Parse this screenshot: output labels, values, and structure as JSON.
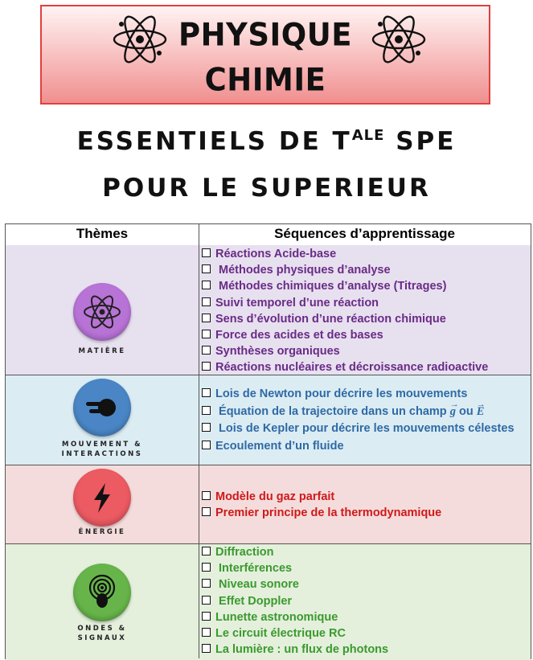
{
  "banner": {
    "line1": "PHYSIQUE",
    "line2": "CHIMIE",
    "icons": [
      "atom-icon",
      "atom-icon"
    ]
  },
  "subtitle": {
    "line1_before": "ESSENTIELS DE T",
    "line1_sup": "ALE",
    "line1_after": " SPE",
    "line2": "POUR LE SUPERIEUR"
  },
  "table": {
    "headers": [
      "Thèmes",
      "Séquences d’apprentissage"
    ],
    "rows": [
      {
        "theme": "MATIÈRE",
        "icon": "atom-icon",
        "color": "#b873d6",
        "text_color": "#6a2b86",
        "items": [
          "Réactions Acide-base",
          " Méthodes physiques d’analyse",
          " Méthodes chimiques d’analyse (Titrages)",
          "Suivi temporel d’une réaction",
          "Sens d’évolution d’une réaction chimique",
          "Force des acides et des bases",
          "Synthèses organiques",
          "Réactions nucléaires et décroissance radioactive"
        ]
      },
      {
        "theme": "MOUVEMENT & INTERACTIONS",
        "theme_line1": "MOUVEMENT &",
        "theme_line2": "INTERACTIONS",
        "icon": "moving-object-icon",
        "color": "#4a86c6",
        "text_color": "#2e6aa6",
        "items": [
          "Lois de Newton pour décrire les mouvements",
          " Équation de la trajectoire dans un champ",
          " Lois de Kepler pour décrire les mouvements célestes",
          "Ecoulement d’un fluide"
        ],
        "item2_vec_g": "g",
        "item2_ou": "ou",
        "item2_vec_e": "E"
      },
      {
        "theme": "ÉNERGIE",
        "icon": "lightning-icon",
        "color": "#ec5a62",
        "text_color": "#d01919",
        "items": [
          "Modèle du gaz parfait",
          "Premier principe de la thermodynamique"
        ]
      },
      {
        "theme": "ONDES & SIGNAUX",
        "theme_line1": "ONDES &",
        "theme_line2": "SIGNAUX",
        "icon": "signal-waves-icon",
        "color": "#67b54a",
        "text_color": "#3a9a2e",
        "items": [
          "Diffraction",
          " Interférences",
          " Niveau sonore",
          " Effet Doppler",
          "Lunette astronomique",
          "Le circuit électrique RC",
          "La lumière : un flux de photons"
        ]
      }
    ]
  }
}
